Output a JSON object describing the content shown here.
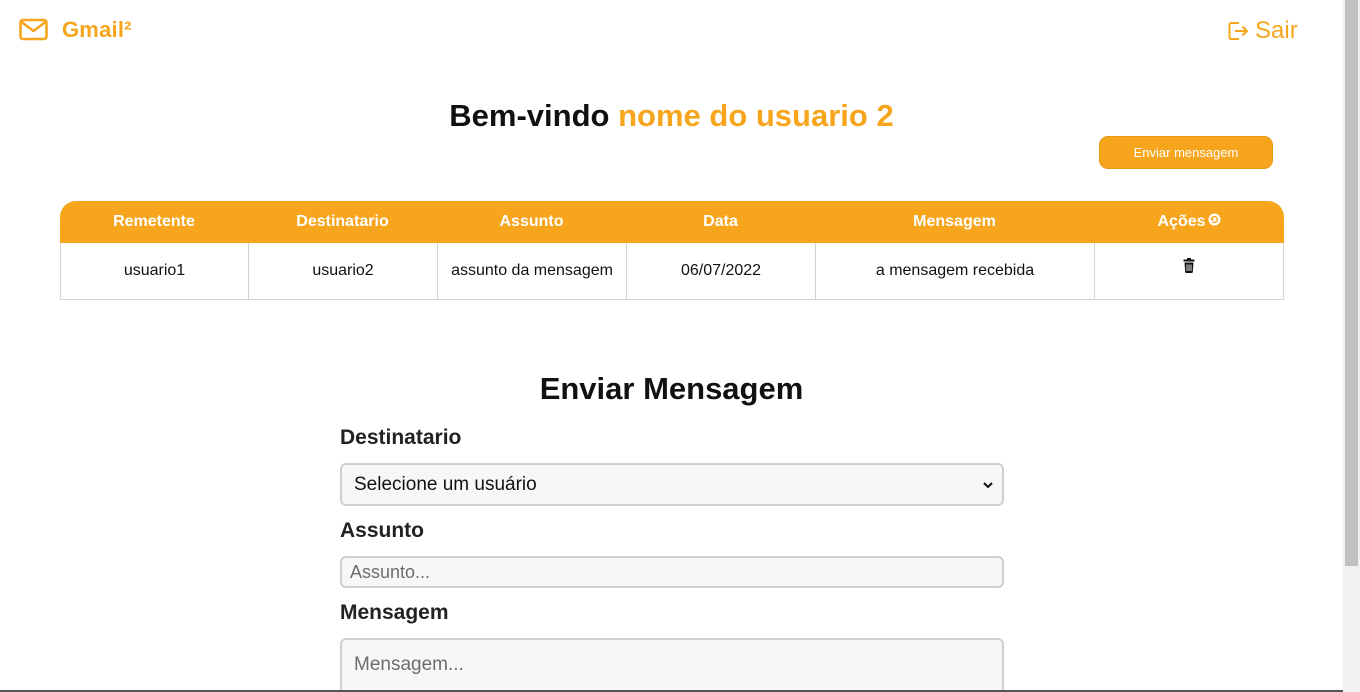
{
  "header": {
    "brand": "Gmail²",
    "logout_label": "Sair",
    "icons": {
      "brand": "mail-icon",
      "logout": "logout-icon"
    }
  },
  "welcome": {
    "prefix": "Bem-vindo ",
    "username": "nome do usuario 2"
  },
  "send_button_label": "Enviar mensagem",
  "table": {
    "columns": [
      "Remetente",
      "Destinatario",
      "Assunto",
      "Data",
      "Mensagem",
      "Ações"
    ],
    "rows": [
      {
        "remetente": "usuario1",
        "destinatario": "usuario2",
        "assunto": "assunto da mensagem",
        "data": "06/07/2022",
        "mensagem": "a mensagem recebida"
      }
    ],
    "action_icon": "trash-icon",
    "header_action_icon": "refresh-icon"
  },
  "form": {
    "title": "Enviar Mensagem",
    "destinatario_label": "Destinatario",
    "destinatario_selected": "Selecione um usuário",
    "assunto_label": "Assunto",
    "assunto_placeholder": "Assunto...",
    "mensagem_label": "Mensagem",
    "mensagem_placeholder": "Mensagem..."
  },
  "colors": {
    "accent": "#f7a51d",
    "border": "#d4d4d4",
    "field_bg": "#f7f7f7"
  }
}
